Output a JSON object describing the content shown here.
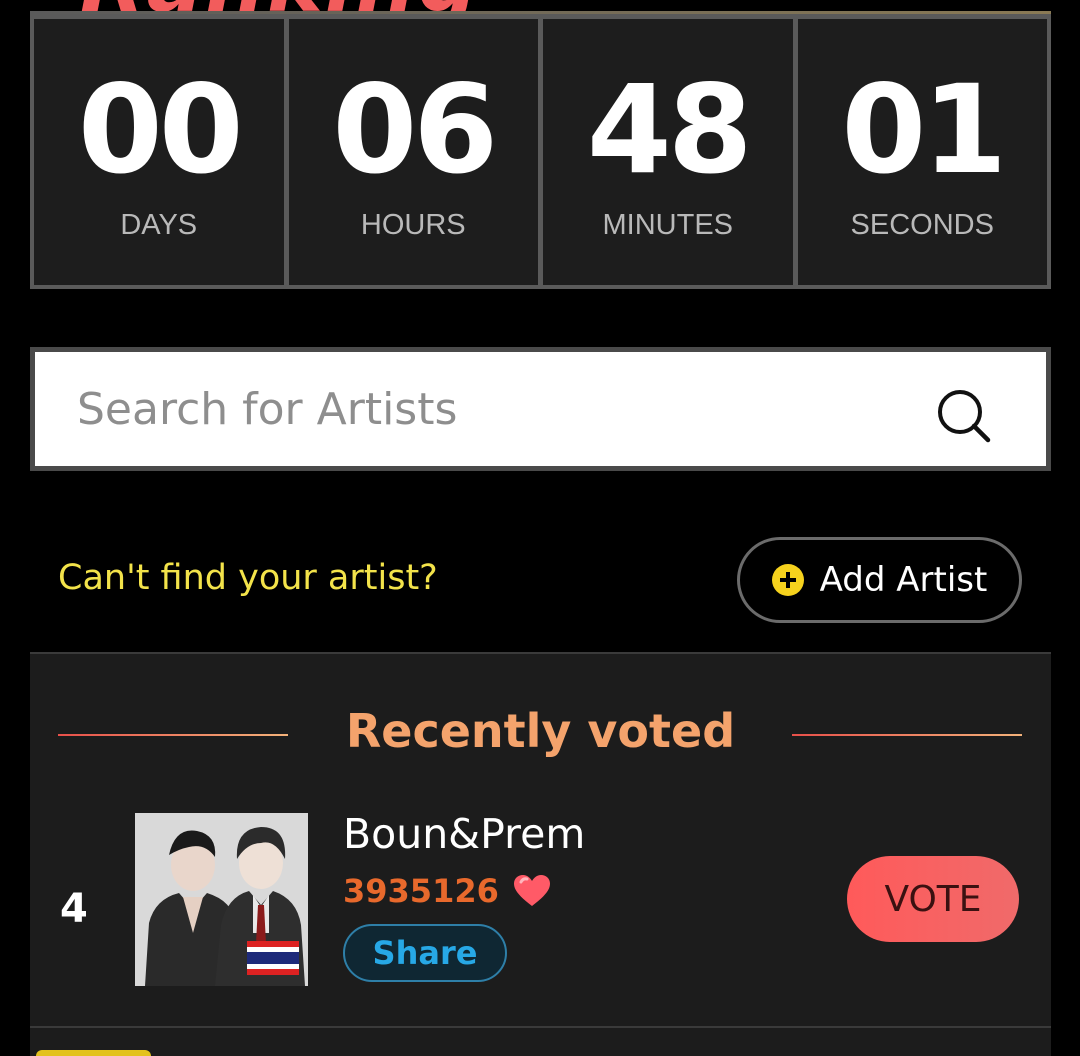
{
  "countdown": {
    "days": {
      "value": "00",
      "label": "DAYS"
    },
    "hours": {
      "value": "06",
      "label": "HOURS"
    },
    "minutes": {
      "value": "48",
      "label": "MINUTES"
    },
    "seconds": {
      "value": "01",
      "label": "SECONDS"
    }
  },
  "search": {
    "placeholder": "Search for Artists",
    "icon": "search-icon"
  },
  "cant_find": {
    "text": "Can't find your artist?",
    "add_label": "Add Artist"
  },
  "recently_voted": {
    "title": "Recently voted",
    "entries": [
      {
        "rank": "4",
        "name": "Boun&Prem",
        "votes": "3935126",
        "share_label": "Share",
        "vote_label": "VOTE",
        "flag": "thailand-flag"
      }
    ]
  },
  "colors": {
    "accent_red": "#f25c5c",
    "title_orange": "#f4a36c",
    "vote_count": "#e8692c",
    "share_blue": "#27a8e6",
    "cant_find_yellow": "#f3e34a"
  }
}
